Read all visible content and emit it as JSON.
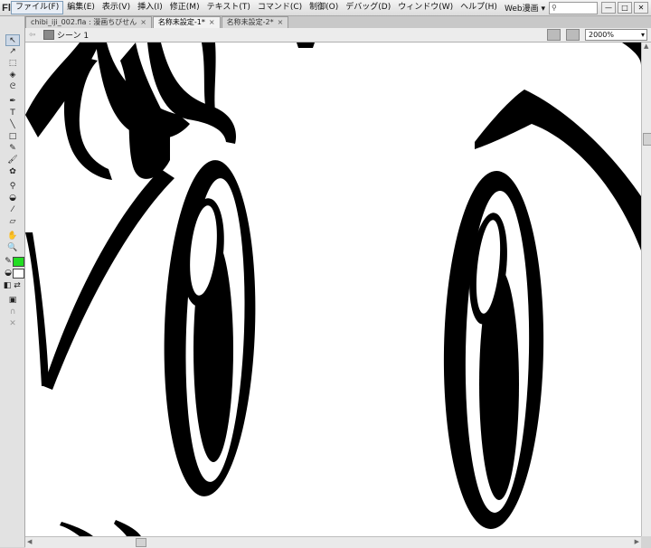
{
  "app": {
    "logo": "Fl"
  },
  "menu": [
    "ファイル(F)",
    "編集(E)",
    "表示(V)",
    "挿入(I)",
    "修正(M)",
    "テキスト(T)",
    "コマンド(C)",
    "制御(O)",
    "デバッグ(D)",
    "ウィンドウ(W)",
    "ヘルプ(H)"
  ],
  "workspace": "Web漫画",
  "window_buttons": [
    "—",
    "□",
    "✕"
  ],
  "tabs": [
    {
      "label": "chibi_iji_002.fla : 漫画ちびせん",
      "close": "×"
    },
    {
      "label": "名称未設定-1*",
      "close": "×"
    },
    {
      "label": "名称未設定-2*",
      "close": "×"
    }
  ],
  "editbar": {
    "scene": "シーン 1",
    "zoom": "2000%"
  },
  "tools": [
    {
      "name": "selection-tool",
      "glyph": "↖"
    },
    {
      "name": "subselection-tool",
      "glyph": "↗"
    },
    {
      "name": "free-transform-tool",
      "glyph": "⬚"
    },
    {
      "name": "3d-rotation-tool",
      "glyph": "◈"
    },
    {
      "name": "lasso-tool",
      "glyph": "ᘓ"
    },
    {
      "name": "pen-tool",
      "glyph": "✒"
    },
    {
      "name": "text-tool",
      "glyph": "T"
    },
    {
      "name": "line-tool",
      "glyph": "╲"
    },
    {
      "name": "rectangle-tool",
      "glyph": "□"
    },
    {
      "name": "pencil-tool",
      "glyph": "✎"
    },
    {
      "name": "brush-tool",
      "glyph": "🖌"
    },
    {
      "name": "deco-tool",
      "glyph": "✿"
    },
    {
      "name": "bone-tool",
      "glyph": "⚲"
    },
    {
      "name": "paint-bucket-tool",
      "glyph": "◒"
    },
    {
      "name": "eyedropper-tool",
      "glyph": "⁄"
    },
    {
      "name": "eraser-tool",
      "glyph": "▱"
    },
    {
      "name": "hand-tool",
      "glyph": "✋"
    },
    {
      "name": "zoom-tool",
      "glyph": "🔍"
    }
  ],
  "colors": {
    "stroke": "#22dd22",
    "fill": "#ffffff",
    "accent": "#7f9db9"
  }
}
